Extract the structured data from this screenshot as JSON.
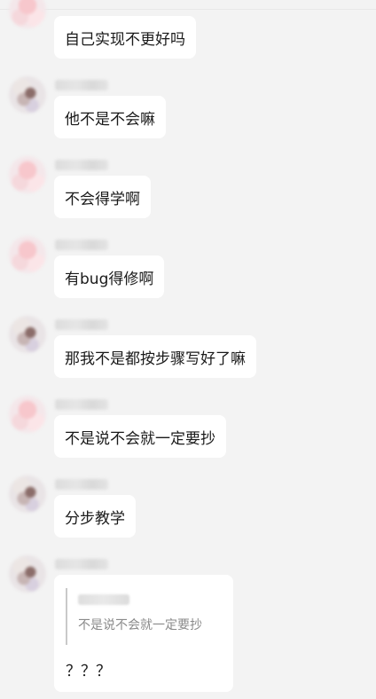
{
  "messages": [
    {
      "sender": "",
      "avatar": "pink-avatar",
      "text": "自己实现不更好吗"
    },
    {
      "sender": "",
      "avatar": "brown-avatar",
      "text": "他不是不会嘛"
    },
    {
      "sender": "",
      "avatar": "pink-avatar",
      "text": "不会得学啊"
    },
    {
      "sender": "",
      "avatar": "pink-avatar",
      "text": "有bug得修啊"
    },
    {
      "sender": "",
      "avatar": "brown-avatar",
      "text": "那我不是都按步骤写好了嘛"
    },
    {
      "sender": "",
      "avatar": "pink-avatar",
      "text": "不是说不会就一定要抄"
    },
    {
      "sender": "",
      "avatar": "brown-avatar",
      "text": "分步教学"
    },
    {
      "sender": "",
      "avatar": "brown-avatar",
      "quote": {
        "sender": "",
        "text": "不是说不会就一定要抄"
      },
      "text": "？？？"
    }
  ]
}
